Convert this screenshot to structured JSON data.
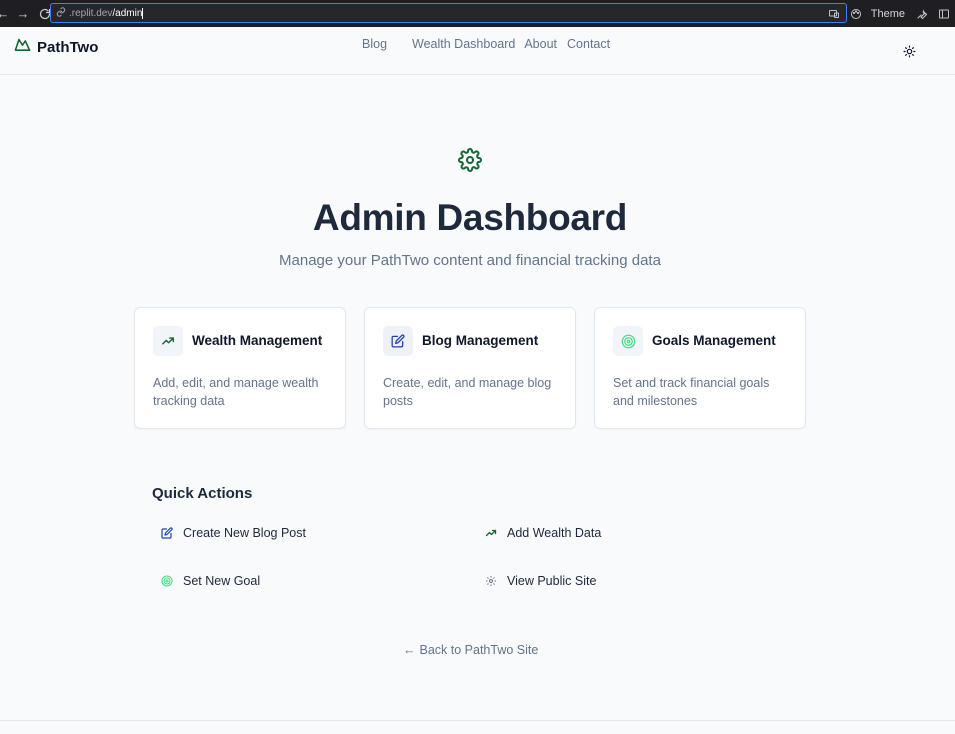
{
  "browser": {
    "url_domain": ".replit.dev",
    "url_path": "/admin",
    "theme_label": "Theme"
  },
  "header": {
    "logo": "PathTwo",
    "nav": [
      "Blog",
      "Wealth Dashboard",
      "About",
      "Contact"
    ]
  },
  "hero": {
    "title": "Admin Dashboard",
    "subtitle": "Manage your PathTwo content and financial tracking data"
  },
  "cards": [
    {
      "title": "Wealth Management",
      "desc": "Add, edit, and manage wealth tracking data",
      "icon": "trending-up-icon"
    },
    {
      "title": "Blog Management",
      "desc": "Create, edit, and manage blog posts",
      "icon": "edit-icon"
    },
    {
      "title": "Goals Management",
      "desc": "Set and track financial goals and milestones",
      "icon": "target-icon"
    }
  ],
  "quick_actions": {
    "title": "Quick Actions",
    "items": [
      {
        "label": "Create New Blog Post",
        "icon": "edit-icon"
      },
      {
        "label": "Add Wealth Data",
        "icon": "trending-up-icon"
      },
      {
        "label": "Set New Goal",
        "icon": "target-icon"
      },
      {
        "label": "View Public Site",
        "icon": "gear-icon"
      }
    ]
  },
  "back_link": "Back to PathTwo Site",
  "colors": {
    "brand_green": "#166534",
    "target_green": "#4ade80",
    "focus_blue": "#3b82f6"
  }
}
